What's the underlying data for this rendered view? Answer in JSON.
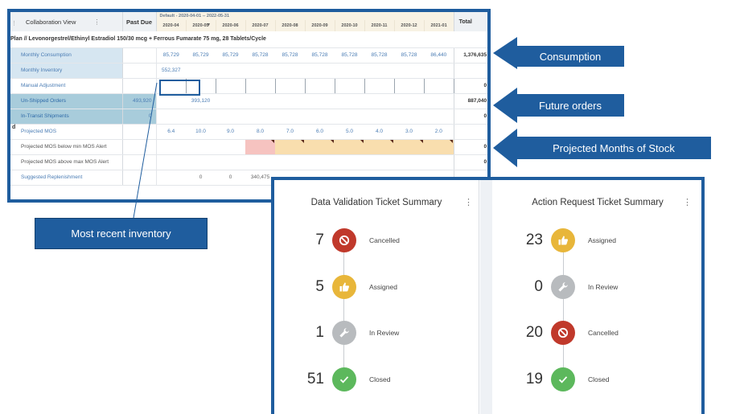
{
  "grid": {
    "view_label": "Collaboration View",
    "past_due_label": "Past Due",
    "date_range": "Default - 2020-04-01 -- 2022-05-31",
    "total_label": "Total",
    "months": [
      "2020-04",
      "2020-05",
      "2020-06",
      "2020-07",
      "2020-08",
      "2020-09",
      "2020-10",
      "2020-11",
      "2020-12",
      "2021-01"
    ],
    "plan_title": "Plan // Levonorgestrel/Ethinyl Estradiol 150/30 mcg + Ferrous Fumarate 75 mg, 28 Tablets/Cycle",
    "side_letter": "d",
    "rows": [
      {
        "label": "Monthly Consumption",
        "past": "",
        "values": [
          "85,729",
          "85,729",
          "85,729",
          "85,728",
          "85,728",
          "85,728",
          "85,728",
          "85,728",
          "85,728",
          "86,440"
        ],
        "total": "1,376,635"
      },
      {
        "label": "Monthly Inventory",
        "past": "",
        "values": [
          "552,327",
          "",
          "",
          "",
          "",
          "",
          "",
          "",
          "",
          ""
        ],
        "total": ""
      },
      {
        "label": "Manual Adjustment",
        "past": "",
        "values": [
          "",
          "",
          "",
          "",
          "",
          "",
          "",
          "",
          "",
          ""
        ],
        "total": "0"
      },
      {
        "label": "Un-Shipped Orders",
        "past": "493,920",
        "values": [
          "",
          "393,120",
          "",
          "",
          "",
          "",
          "",
          "",
          "",
          ""
        ],
        "total": "887,040"
      },
      {
        "label": "In-Transit Shipments",
        "past": "0",
        "values": [
          "",
          "",
          "",
          "",
          "",
          "",
          "",
          "",
          "",
          ""
        ],
        "total": "0"
      },
      {
        "label": "Projected MOS",
        "past": "",
        "values": [
          "6.4",
          "10.0",
          "9.0",
          "8.0",
          "7.0",
          "6.0",
          "5.0",
          "4.0",
          "3.0",
          "2.0"
        ],
        "total": ""
      },
      {
        "label": "Projected MOS below min MOS Alert",
        "past": "",
        "values": [
          "",
          "",
          "",
          "",
          "",
          "",
          "",
          "",
          "",
          ""
        ],
        "total": "0"
      },
      {
        "label": "Projected MOS above max MOS Alert",
        "past": "",
        "values": [
          "",
          "",
          "",
          "",
          "",
          "",
          "",
          "",
          "",
          ""
        ],
        "total": "0"
      },
      {
        "label": "Suggested Replenishment",
        "past": "",
        "values": [
          "",
          "0",
          "0",
          "340,475",
          "",
          "",
          "",
          "",
          "",
          ""
        ],
        "total": ""
      }
    ]
  },
  "callouts": {
    "consumption": "Consumption",
    "future_orders": "Future orders",
    "projected_mos": "Projected Months of Stock",
    "recent_inventory": "Most recent inventory"
  },
  "tickets": {
    "data_validation": {
      "title": "Data Validation Ticket Summary",
      "items": [
        {
          "count": "7",
          "label": "Cancelled",
          "icon": "ban-icon",
          "color": "#c0392b"
        },
        {
          "count": "5",
          "label": "Assigned",
          "icon": "thumbs-up-icon",
          "color": "#e8b63a"
        },
        {
          "count": "1",
          "label": "In Review",
          "icon": "wrench-icon",
          "color": "#b8bbbe"
        },
        {
          "count": "51",
          "label": "Closed",
          "icon": "check-icon",
          "color": "#5cb85c"
        }
      ]
    },
    "action_request": {
      "title": "Action Request Ticket Summary",
      "items": [
        {
          "count": "23",
          "label": "Assigned",
          "icon": "thumbs-up-icon",
          "color": "#e8b63a"
        },
        {
          "count": "0",
          "label": "In Review",
          "icon": "wrench-icon",
          "color": "#b8bbbe"
        },
        {
          "count": "20",
          "label": "Cancelled",
          "icon": "ban-icon",
          "color": "#c0392b"
        },
        {
          "count": "19",
          "label": "Closed",
          "icon": "check-icon",
          "color": "#5cb85c"
        }
      ]
    }
  }
}
